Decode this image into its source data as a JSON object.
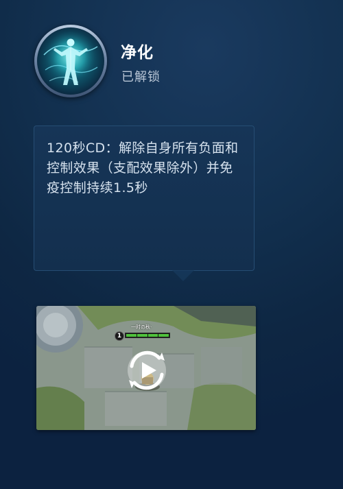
{
  "skill": {
    "name": "净化",
    "status": "已解锁",
    "icon": "purify-spirit-icon"
  },
  "description": {
    "text": "120秒CD：解除自身所有负面和控制效果（支配效果除外）并免疫控制持续1.5秒"
  },
  "video": {
    "hud_player_name": "一时の秋·",
    "hud_level": "1",
    "health_fraction": 1.0,
    "play_icon": "play-icon"
  }
}
